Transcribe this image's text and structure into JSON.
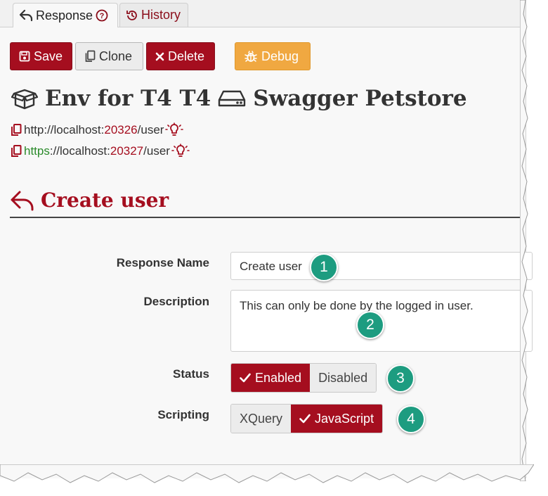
{
  "tabs": [
    {
      "label": "Response",
      "icon": "reply-icon",
      "extra_icon": "help-circle-icon",
      "active": true
    },
    {
      "label": "History",
      "icon": "history-icon",
      "active": false
    }
  ],
  "toolbar": {
    "save_label": "Save",
    "clone_label": "Clone",
    "delete_label": "Delete",
    "debug_label": "Debug"
  },
  "header": {
    "env_name": "Env for T4 T4",
    "service_name": "Swagger Petstore"
  },
  "urls": [
    {
      "scheme": "http",
      "rest": "://localhost:",
      "port": "20326",
      "path": "/user"
    },
    {
      "scheme": "https",
      "rest": "://localhost:",
      "port": "20327",
      "path": "/user"
    }
  ],
  "section": {
    "title": "Create user"
  },
  "form": {
    "response_name_label": "Response Name",
    "response_name_value": "Create user",
    "description_label": "Description",
    "description_value": "This can only be done by the logged in user.",
    "status_label": "Status",
    "status_options": [
      "Enabled",
      "Disabled"
    ],
    "status_selected": "Enabled",
    "scripting_label": "Scripting",
    "scripting_options": [
      "XQuery",
      "JavaScript"
    ],
    "scripting_selected": "JavaScript"
  },
  "callouts": [
    "1",
    "2",
    "3",
    "4"
  ],
  "colors": {
    "accent": "#a50e1f",
    "warning": "#f0a841",
    "callout": "#1d9c80",
    "https": "#2a8a2a"
  }
}
